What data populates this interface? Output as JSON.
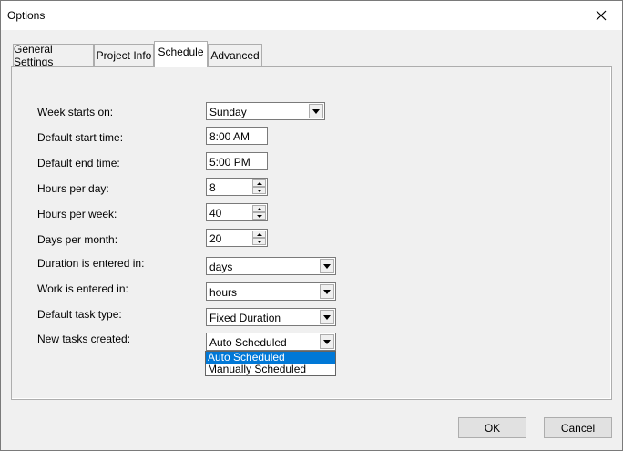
{
  "window": {
    "title": "Options"
  },
  "tabs": [
    {
      "label": "General Settings",
      "active": false
    },
    {
      "label": "Project Info",
      "active": false
    },
    {
      "label": "Schedule",
      "active": true
    },
    {
      "label": "Advanced",
      "active": false
    }
  ],
  "schedule": {
    "week_starts_on": {
      "label": "Week starts on:",
      "value": "Sunday"
    },
    "default_start_time": {
      "label": "Default start time:",
      "value": "8:00 AM"
    },
    "default_end_time": {
      "label": "Default end time:",
      "value": "5:00 PM"
    },
    "hours_per_day": {
      "label": "Hours per day:",
      "value": "8"
    },
    "hours_per_week": {
      "label": "Hours per week:",
      "value": "40"
    },
    "days_per_month": {
      "label": "Days per month:",
      "value": "20"
    },
    "duration_entered_in": {
      "label": "Duration is entered in:",
      "value": "days"
    },
    "work_entered_in": {
      "label": "Work is entered in:",
      "value": "hours"
    },
    "default_task_type": {
      "label": "Default task type:",
      "value": "Fixed Duration"
    },
    "new_tasks_created": {
      "label": "New tasks created:",
      "value": "Auto Scheduled",
      "options": [
        "Auto Scheduled",
        "Manually Scheduled"
      ]
    }
  },
  "buttons": {
    "ok": "OK",
    "cancel": "Cancel"
  },
  "colors": {
    "selection": "#0078d7",
    "dialog_bg": "#f0f0f0"
  }
}
